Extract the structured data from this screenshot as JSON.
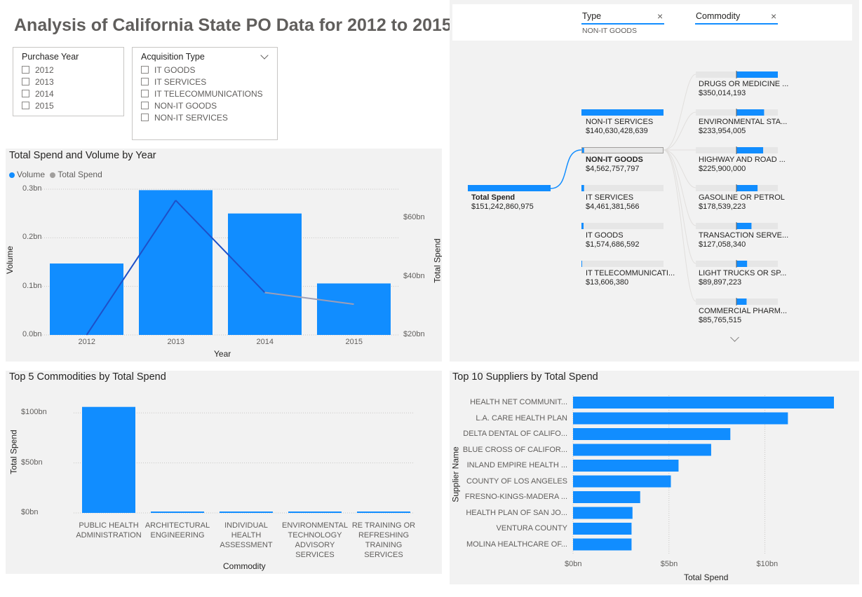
{
  "page_title": "Analysis of California State PO Data for 2012 to 2015",
  "purchase_year_slicer": {
    "title": "Purchase Year",
    "options": [
      "2012",
      "2013",
      "2014",
      "2015"
    ]
  },
  "acquisition_type_slicer": {
    "title": "Acquisition Type",
    "options": [
      "IT GOODS",
      "IT SERVICES",
      "IT TELECOMMUNICATIONS",
      "NON-IT GOODS",
      "NON-IT SERVICES"
    ]
  },
  "decomposition_tree": {
    "filters": [
      {
        "field": "Type",
        "value": "NON-IT GOODS"
      },
      {
        "field": "Commodity",
        "value": ""
      }
    ],
    "root": {
      "label": "Total Spend",
      "value": "$151,242,860,975"
    },
    "level1": [
      {
        "label": "NON-IT SERVICES",
        "value": "$140,630,428,639",
        "share": 1.0
      },
      {
        "label": "NON-IT GOODS",
        "value": "$4,562,757,797",
        "share": 0.032,
        "selected": true
      },
      {
        "label": "IT SERVICES",
        "value": "$4,461,381,566",
        "share": 0.032
      },
      {
        "label": "IT GOODS",
        "value": "$1,574,686,592",
        "share": 0.011
      },
      {
        "label": "IT TELECOMMUNICATI...",
        "value": "$13,606,380",
        "share": 0.0
      }
    ],
    "level2": [
      {
        "label": "DRUGS OR MEDICINE ...",
        "value": "$350,014,193",
        "share": 1.0
      },
      {
        "label": "ENVIRONMENTAL STA...",
        "value": "$233,954,005",
        "share": 0.668
      },
      {
        "label": "HIGHWAY AND ROAD ...",
        "value": "$225,900,000",
        "share": 0.645
      },
      {
        "label": "GASOLINE OR PETROL",
        "value": "$178,539,223",
        "share": 0.51
      },
      {
        "label": "TRANSACTION SERVE...",
        "value": "$127,058,340",
        "share": 0.363
      },
      {
        "label": "LIGHT TRUCKS OR SP...",
        "value": "$89,897,223",
        "share": 0.257
      },
      {
        "label": "COMMERCIAL PHARM...",
        "value": "$85,765,515",
        "share": 0.245
      }
    ]
  },
  "spend_volume_chart": {
    "title": "Total Spend and Volume by Year",
    "legend": [
      "Volume",
      "Total Spend"
    ],
    "colors": {
      "volume": "#118dff",
      "spend": "#9e9eb6",
      "spend_dark": "#1e50c8"
    },
    "chart_data": {
      "type": "bar",
      "categories": [
        "2012",
        "2013",
        "2014",
        "2015"
      ],
      "series": [
        {
          "name": "Volume",
          "values": [
            0.147,
            0.298,
            0.25,
            0.106
          ]
        },
        {
          "name": "Total Spend",
          "values": [
            20,
            66,
            34.5,
            30.5
          ]
        }
      ],
      "xlabel": "Year",
      "ylabel": "Volume",
      "y2label": "Total Spend",
      "ylim": [
        0,
        0.3
      ],
      "y2lim": [
        20,
        60
      ],
      "yticks": [
        "0.0bn",
        "0.1bn",
        "0.2bn",
        "0.3bn"
      ],
      "y2ticks": [
        "$20bn",
        "$40bn",
        "$60bn"
      ]
    }
  },
  "top_commodities_chart": {
    "title": "Top 5 Commodities by Total Spend",
    "chart_data": {
      "type": "bar",
      "categories": [
        "PUBLIC HEALTH ADMINISTRATION",
        "ARCHITECTURAL ENGINEERING",
        "INDIVIDUAL HEALTH ASSESSMENT",
        "ENVIRONMENTAL TECHNOLOGY ADVISORY SERVICES",
        "RE TRAINING OR REFRESHING TRAINING SERVICES"
      ],
      "values": [
        106,
        1.2,
        1.1,
        1.0,
        0.9
      ],
      "xlabel": "Commodity",
      "ylabel": "Total Spend",
      "ylim": [
        0,
        110
      ],
      "yticks": [
        "$0bn",
        "$50bn",
        "$100bn"
      ]
    }
  },
  "top_suppliers_chart": {
    "title": "Top 10 Suppliers by Total Spend",
    "chart_data": {
      "type": "bar",
      "categories": [
        "HEALTH NET COMMUNIT...",
        "L.A. CARE HEALTH PLAN",
        "DELTA DENTAL OF CALIFO...",
        "BLUE CROSS OF CALIFOR...",
        "INLAND EMPIRE HEALTH ...",
        "COUNTY OF LOS ANGELES",
        "FRESNO-KINGS-MADERA ...",
        "HEALTH PLAN OF SAN JO...",
        "VENTURA COUNTY",
        "MOLINA HEALTHCARE OF..."
      ],
      "values": [
        13.6,
        11.2,
        8.2,
        7.2,
        5.5,
        5.1,
        3.5,
        3.1,
        3.05,
        3.05
      ],
      "xlabel": "Total Spend",
      "ylabel": "Supplier Name",
      "xlim": [
        0,
        13.6
      ],
      "xticks": [
        "$0bn",
        "$5bn",
        "$10bn"
      ]
    }
  }
}
